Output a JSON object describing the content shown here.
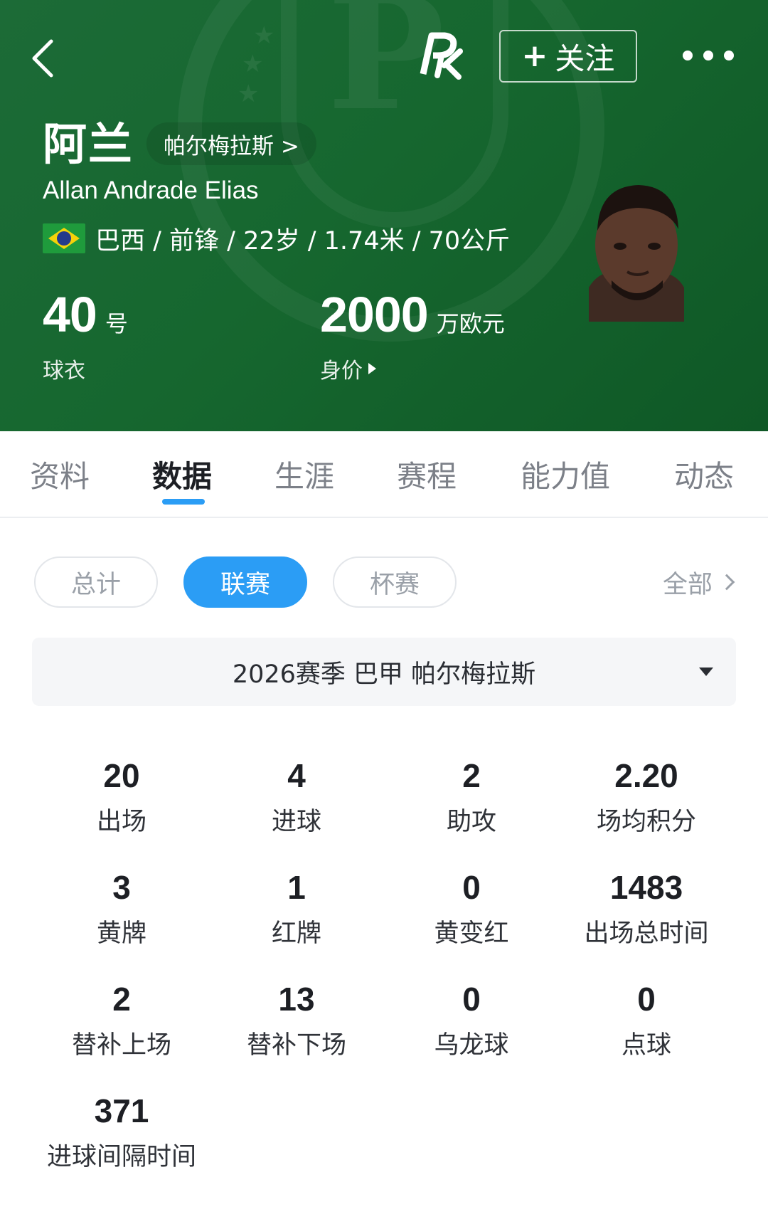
{
  "header": {
    "follow_label": "关注",
    "follow_plus": "+",
    "player_name_cn": "阿兰",
    "team_link": "帕尔梅拉斯 >",
    "player_name_en": "Allan Andrade Elias",
    "info": "巴西 / 前锋 / 22岁 / 1.74米 / 70公斤",
    "flag_icon": "brazil-flag-icon",
    "shirt": {
      "value": "40",
      "unit": "号",
      "label": "球衣"
    },
    "market_value": {
      "value": "2000",
      "unit": "万欧元",
      "label": "身价"
    },
    "brand_color": "#1a6a34"
  },
  "tabs": [
    "资料",
    "数据",
    "生涯",
    "赛程",
    "能力值",
    "动态"
  ],
  "active_tab": "数据",
  "filters": {
    "pills": [
      "总计",
      "联赛",
      "杯赛"
    ],
    "active": "联赛",
    "all_label": "全部",
    "accent": "#2b9df5"
  },
  "season_select": "2026赛季 巴甲 帕尔梅拉斯",
  "stats": [
    {
      "value": "20",
      "label": "出场"
    },
    {
      "value": "4",
      "label": "进球"
    },
    {
      "value": "2",
      "label": "助攻"
    },
    {
      "value": "2.20",
      "label": "场均积分"
    },
    {
      "value": "3",
      "label": "黄牌"
    },
    {
      "value": "1",
      "label": "红牌"
    },
    {
      "value": "0",
      "label": "黄变红"
    },
    {
      "value": "1483",
      "label": "出场总时间"
    },
    {
      "value": "2",
      "label": "替补上场"
    },
    {
      "value": "13",
      "label": "替补下场"
    },
    {
      "value": "0",
      "label": "乌龙球"
    },
    {
      "value": "0",
      "label": "点球"
    },
    {
      "value": "371",
      "label": "进球间隔时间"
    }
  ]
}
